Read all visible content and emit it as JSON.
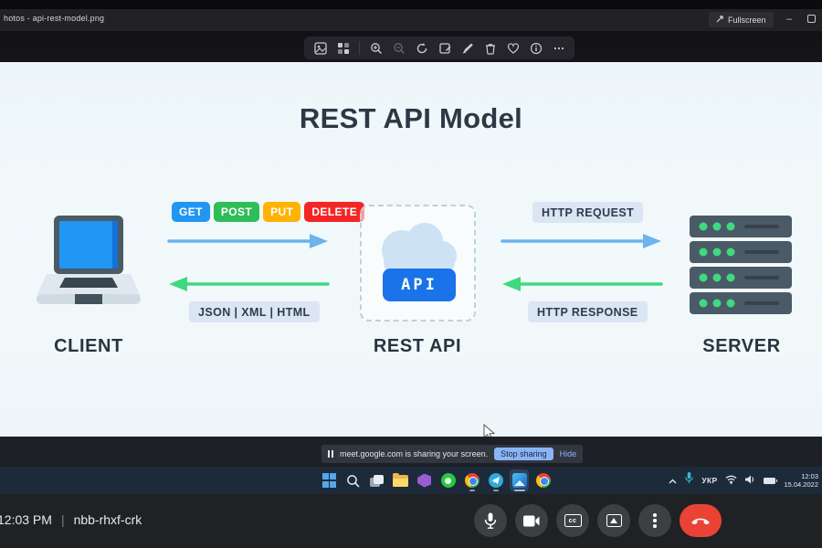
{
  "window": {
    "title": "hotos - api-rest-model.png",
    "fullscreen_label": "Fullscreen",
    "toolbar_icons": [
      "edit-image",
      "see-all-photos",
      "zoom-in",
      "zoom-out",
      "rotate",
      "crop",
      "draw",
      "delete",
      "favorite",
      "info",
      "more"
    ]
  },
  "diagram": {
    "title": "REST API Model",
    "client_label": "CLIENT",
    "rest_api_label": "REST API",
    "server_label": "SERVER",
    "api_button": "API",
    "methods": [
      {
        "label": "GET",
        "color": "#2196f3"
      },
      {
        "label": "POST",
        "color": "#2ebd59"
      },
      {
        "label": "PUT",
        "color": "#ffb300"
      },
      {
        "label": "DELETE",
        "color": "#f42525"
      }
    ],
    "formats_label": "JSON | XML | HTML",
    "request_label": "HTTP REQUEST",
    "response_label": "HTTP RESPONSE",
    "arrow_colors": {
      "request": "#6cb3f0",
      "response": "#3fd980"
    }
  },
  "share_banner": {
    "message": "meet.google.com is sharing your screen.",
    "stop_button": "Stop sharing",
    "hide_link": "Hide"
  },
  "taskbar": {
    "language": "УКР",
    "time": "12:03",
    "date": "15.04.2022"
  },
  "meet": {
    "clock": "12:03 PM",
    "separator": "|",
    "code": "nbb-rhxf-crk",
    "controls": [
      "microphone",
      "camera",
      "captions",
      "present",
      "more-options",
      "end-call"
    ],
    "end_call_color": "#ea4335"
  }
}
